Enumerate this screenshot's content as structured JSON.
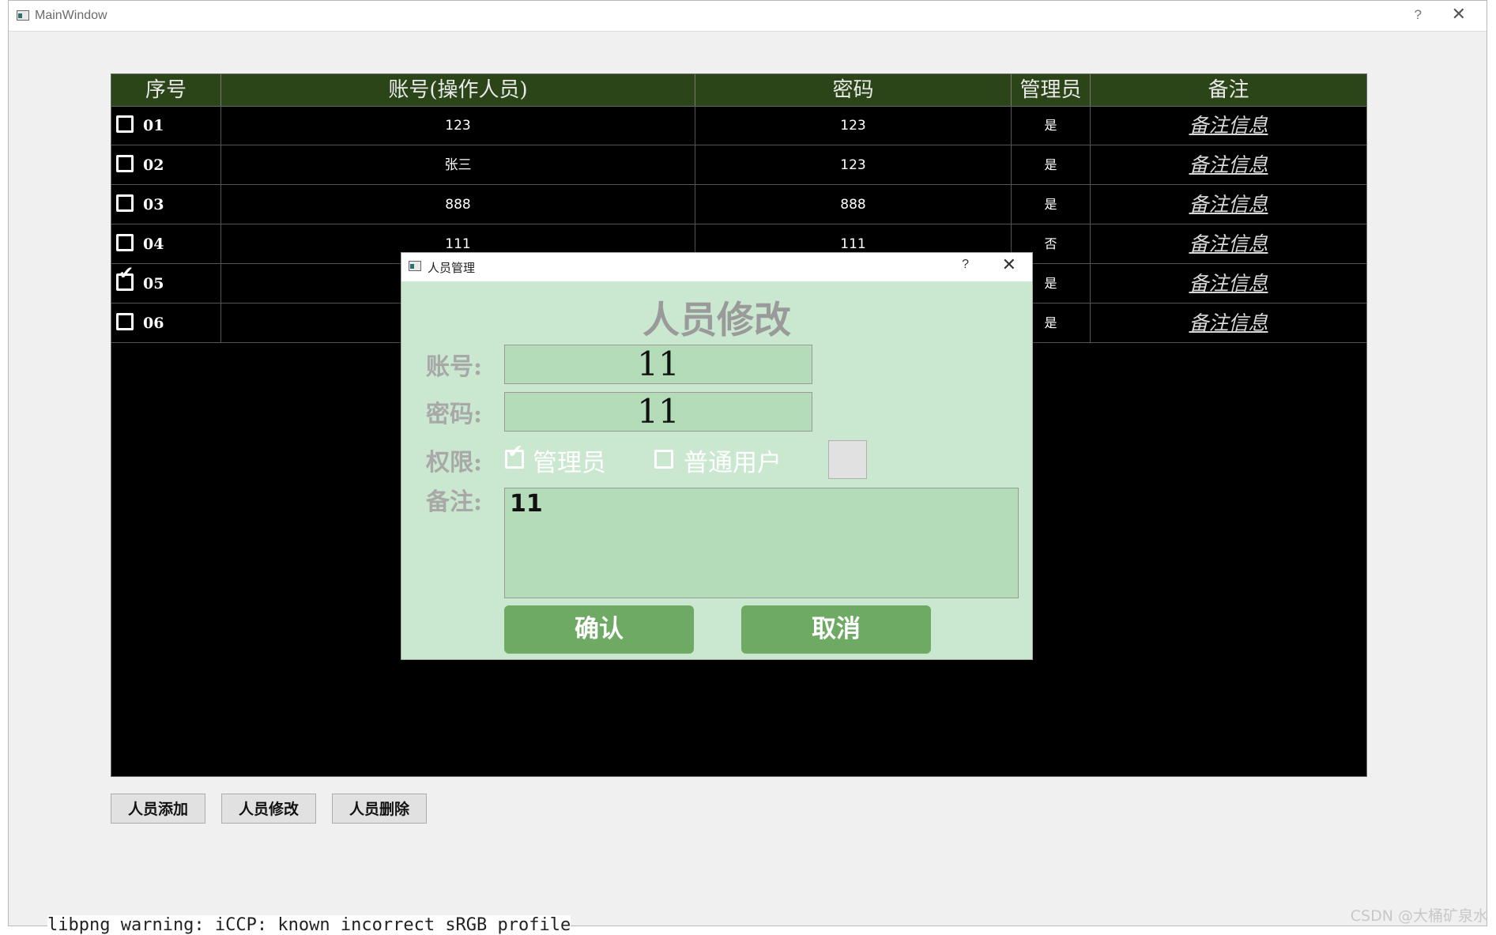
{
  "window": {
    "title": "MainWindow",
    "help": "?",
    "close": "✕"
  },
  "table": {
    "headers": [
      "序号",
      "账号(操作人员)",
      "密码",
      "管理员",
      "备注"
    ],
    "rows": [
      {
        "index": "01",
        "account": "123",
        "password": "123",
        "admin": "是",
        "remark": "备注信息",
        "checked": false
      },
      {
        "index": "02",
        "account": "张三",
        "password": "123",
        "admin": "是",
        "remark": "备注信息",
        "checked": false
      },
      {
        "index": "03",
        "account": "888",
        "password": "888",
        "admin": "是",
        "remark": "备注信息",
        "checked": false
      },
      {
        "index": "04",
        "account": "111",
        "password": "111",
        "admin": "否",
        "remark": "备注信息",
        "checked": false
      },
      {
        "index": "05",
        "account": "",
        "password": "",
        "admin": "是",
        "remark": "备注信息",
        "checked": true
      },
      {
        "index": "06",
        "account": "",
        "password": "",
        "admin": "是",
        "remark": "备注信息",
        "checked": false
      }
    ]
  },
  "buttons": {
    "add": "人员添加",
    "edit": "人员修改",
    "delete": "人员删除"
  },
  "console": "libpng warning: iCCP: known incorrect sRGB profile",
  "dialog": {
    "title": "人员管理",
    "help": "?",
    "close": "✕",
    "heading": "人员修改",
    "account_label": "账号:",
    "account_value": "11",
    "password_label": "密码:",
    "password_value": "11",
    "permission_label": "权限:",
    "admin_option": "管理员",
    "admin_checked": true,
    "normal_option": "普通用户",
    "normal_checked": false,
    "remark_label": "备注:",
    "remark_value": "11",
    "confirm": "确认",
    "cancel": "取消"
  },
  "watermark": "CSDN @大桶矿泉水",
  "colors": {
    "header_bg": "#2b4418",
    "dialog_bg": "#cae7cf",
    "field_bg": "#b4dcb9",
    "button_bg": "#6eaa64"
  }
}
